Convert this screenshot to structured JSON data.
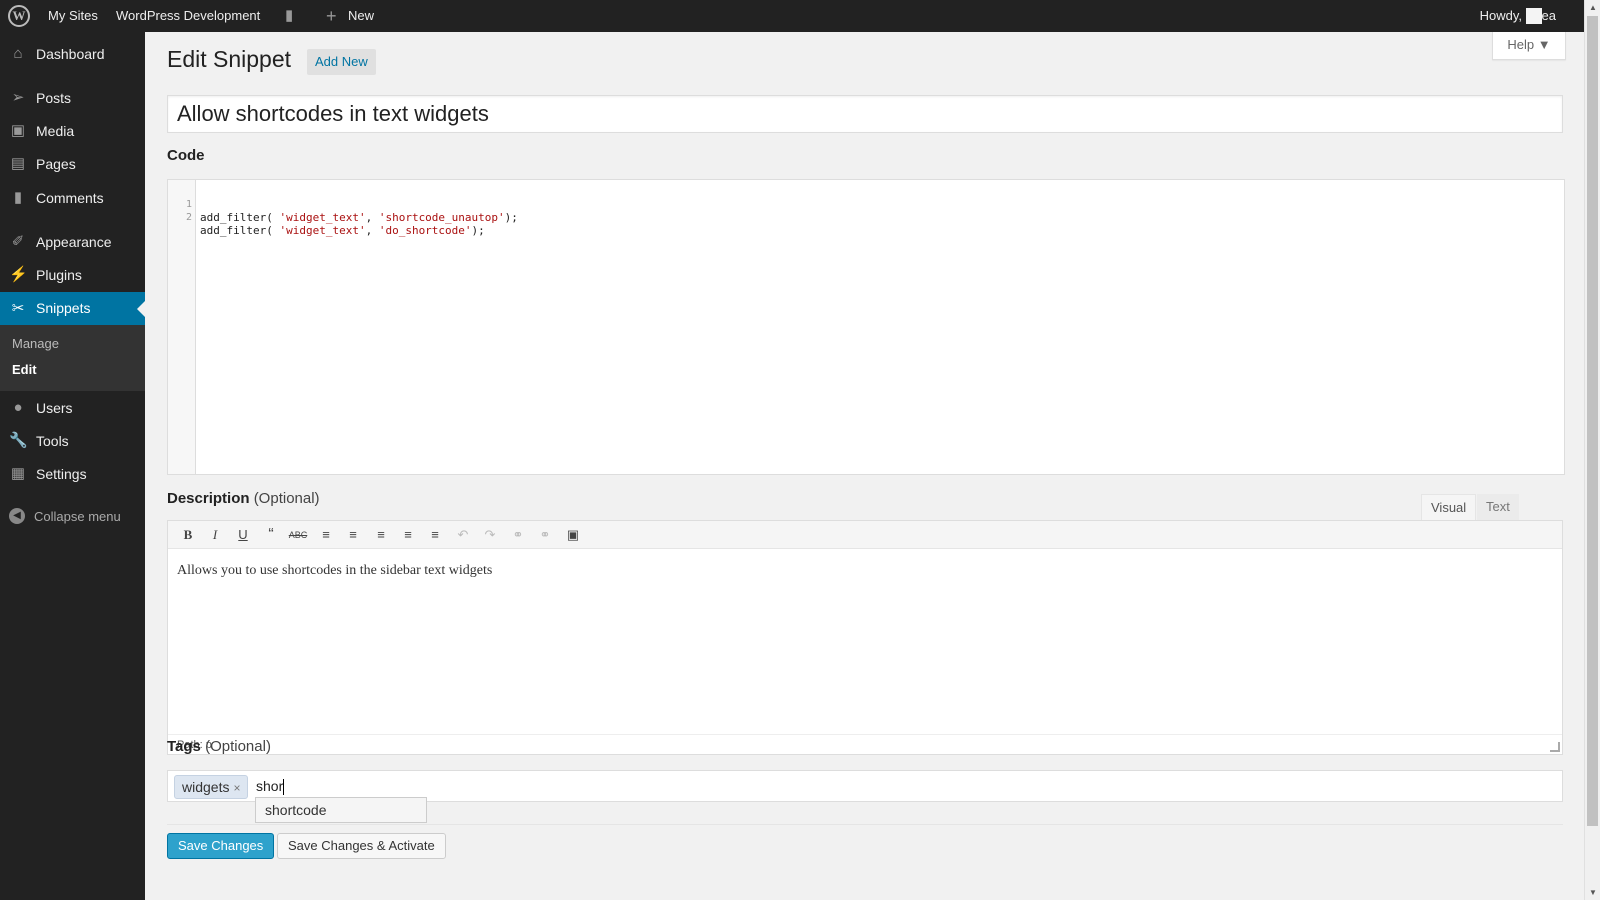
{
  "adminbar": {
    "my_sites": "My Sites",
    "site_name": "WordPress Development",
    "new_label": "New",
    "howdy": "Howdy, Shea"
  },
  "sidebar": {
    "items": [
      {
        "label": "Dashboard",
        "icon": "dashboard-icon"
      },
      {
        "label": "Posts",
        "icon": "pushpin-icon"
      },
      {
        "label": "Media",
        "icon": "media-icon"
      },
      {
        "label": "Pages",
        "icon": "pages-icon"
      },
      {
        "label": "Comments",
        "icon": "comments-icon"
      },
      {
        "label": "Appearance",
        "icon": "paintbrush-icon"
      },
      {
        "label": "Plugins",
        "icon": "plugin-icon"
      },
      {
        "label": "Snippets",
        "icon": "scissors-icon"
      },
      {
        "label": "Users",
        "icon": "user-icon"
      },
      {
        "label": "Tools",
        "icon": "wrench-icon"
      },
      {
        "label": "Settings",
        "icon": "settings-icon"
      }
    ],
    "submenu": [
      "Manage",
      "Edit"
    ],
    "collapse": "Collapse menu"
  },
  "page": {
    "title": "Edit Snippet",
    "add_new": "Add New",
    "help": "Help ▼",
    "snippet_title": "Allow shortcodes in text widgets"
  },
  "code": {
    "label": "Code",
    "lines": [
      {
        "num": "1",
        "pre": "add_filter( ",
        "s1": "'widget_text'",
        "mid": ", ",
        "s2": "'shortcode_unautop'",
        "post": ");"
      },
      {
        "num": "2",
        "pre": "add_filter( ",
        "s1": "'widget_text'",
        "mid": ", ",
        "s2": "'do_shortcode'",
        "post": ");"
      }
    ]
  },
  "description": {
    "label": "Description",
    "optional": "(Optional)",
    "tab_visual": "Visual",
    "tab_text": "Text",
    "body": "Allows you to use shortcodes in the sidebar text widgets",
    "path": "Path: p"
  },
  "tags": {
    "label": "Tags",
    "optional": "(Optional)",
    "chips": [
      "widgets"
    ],
    "input_value": "shor",
    "suggestion": "shortcode"
  },
  "buttons": {
    "save": "Save Changes",
    "save_activate": "Save Changes & Activate"
  },
  "colors": {
    "accent": "#0074a2",
    "primary_button": "#2ea2cc",
    "adminbar": "#222222"
  }
}
